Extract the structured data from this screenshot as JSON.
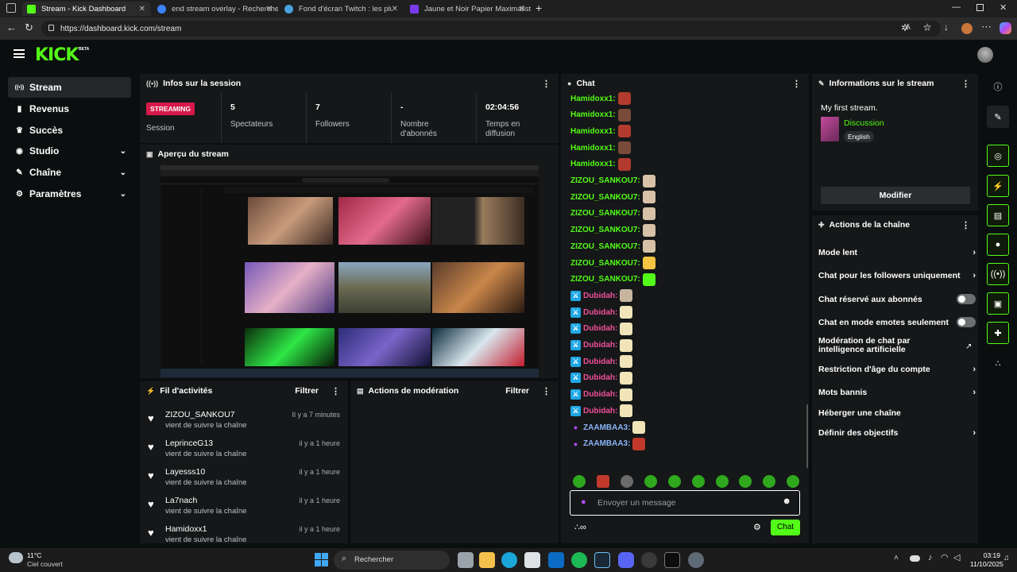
{
  "browser": {
    "tabs": [
      {
        "title": "Stream - Kick Dashboard",
        "color": "#53fc18"
      },
      {
        "title": "end stream overlay - Recherche",
        "color": "#3b82f6"
      },
      {
        "title": "Fond d'écran Twitch : les plus bea",
        "color": "#4aa3df"
      },
      {
        "title": "Jaune et Noir Papier Maximaliste",
        "color": "#7c3aed"
      }
    ],
    "url": "https://dashboard.kick.com/stream"
  },
  "brand": {
    "logo": "KICK",
    "beta": "BETA",
    "accent": "#53fc18"
  },
  "sidebar": {
    "items": [
      {
        "label": "Stream",
        "icon": "broadcast-icon",
        "glyph": "((•))"
      },
      {
        "label": "Revenus",
        "icon": "chart-icon",
        "glyph": "▮"
      },
      {
        "label": "Succès",
        "icon": "trophy-icon",
        "glyph": "♛"
      },
      {
        "label": "Studio",
        "icon": "studio-icon",
        "glyph": "◉"
      },
      {
        "label": "Chaîne",
        "icon": "channel-icon",
        "glyph": "✎"
      },
      {
        "label": "Paramètres",
        "icon": "gear-icon",
        "glyph": "⚙"
      }
    ]
  },
  "session": {
    "title": "Infos sur la session",
    "badge": "STREAMING",
    "badge_label": "Session",
    "stats": [
      {
        "value": "5",
        "label": "Spectateurs"
      },
      {
        "value": "7",
        "label": "Followers"
      },
      {
        "value": "-",
        "label": "Nombre d'abonnés"
      },
      {
        "value": "02:04:56",
        "label": "Temps en diffusion"
      }
    ]
  },
  "preview": {
    "title": "Aperçu du stream"
  },
  "activity": {
    "title": "Fil d'activités",
    "filter": "Filtrer",
    "items": [
      {
        "name": "ZIZOU_SANKOU7",
        "action": "vient de suivre la chaîne",
        "time": "Il y a 7 minutes"
      },
      {
        "name": "LeprinceG13",
        "action": "vient de suivre la chaîne",
        "time": "il y a 1 heure"
      },
      {
        "name": "Layesss10",
        "action": "vient de suivre la chaîne",
        "time": "il y a 1 heure"
      },
      {
        "name": "La7nach",
        "action": "vient de suivre la chaîne",
        "time": "il y a 1 heure"
      },
      {
        "name": "Hamidoxx1",
        "action": "vient de suivre la chaîne",
        "time": "il y a 1 heure"
      }
    ]
  },
  "moderation": {
    "title": "Actions de modération",
    "filter": "Filtrer"
  },
  "chat": {
    "title": "Chat",
    "messages": [
      {
        "user": "Hamidoxx1:",
        "color": "#53fc18",
        "badge": ""
      },
      {
        "user": "Hamidoxx1:",
        "color": "#53fc18",
        "badge": ""
      },
      {
        "user": "Hamidoxx1:",
        "color": "#53fc18",
        "badge": ""
      },
      {
        "user": "Hamidoxx1:",
        "color": "#53fc18",
        "badge": ""
      },
      {
        "user": "Hamidoxx1:",
        "color": "#53fc18",
        "badge": ""
      },
      {
        "user": "ZIZOU_SANKOU7:",
        "color": "#53fc18",
        "badge": ""
      },
      {
        "user": "ZIZOU_SANKOU7:",
        "color": "#53fc18",
        "badge": ""
      },
      {
        "user": "ZIZOU_SANKOU7:",
        "color": "#53fc18",
        "badge": ""
      },
      {
        "user": "ZIZOU_SANKOU7:",
        "color": "#53fc18",
        "badge": ""
      },
      {
        "user": "ZIZOU_SANKOU7:",
        "color": "#53fc18",
        "badge": ""
      },
      {
        "user": "ZIZOU_SANKOU7:",
        "color": "#53fc18",
        "badge": ""
      },
      {
        "user": "ZIZOU_SANKOU7:",
        "color": "#53fc18",
        "badge": ""
      },
      {
        "user": "Dubidah:",
        "color": "#f0509b",
        "badge": "mod"
      },
      {
        "user": "Dubidah:",
        "color": "#f0509b",
        "badge": "mod"
      },
      {
        "user": "Dubidah:",
        "color": "#f0509b",
        "badge": "mod"
      },
      {
        "user": "Dubidah:",
        "color": "#f0509b",
        "badge": "mod"
      },
      {
        "user": "Dubidah:",
        "color": "#f0509b",
        "badge": "mod"
      },
      {
        "user": "Dubidah:",
        "color": "#f0509b",
        "badge": "mod"
      },
      {
        "user": "Dubidah:",
        "color": "#f0509b",
        "badge": "mod"
      },
      {
        "user": "Dubidah:",
        "color": "#f0509b",
        "badge": "mod"
      },
      {
        "user": "ZAAMBAA3:",
        "color": "#8ab4f8",
        "badge": "mic"
      },
      {
        "user": "ZAAMBAA3:",
        "color": "#8ab4f8",
        "badge": "mic"
      }
    ],
    "placeholder": "Envoyer un message",
    "send": "Chat"
  },
  "stream_info": {
    "title": "Informations sur le stream",
    "stream_title": "My first stream.",
    "category": "Discussion",
    "language": "English",
    "edit": "Modifier"
  },
  "channel_actions": {
    "title": "Actions de la chaîne",
    "items": [
      {
        "label": "Mode lent",
        "control": "chevron"
      },
      {
        "label": "Chat pour les followers uniquement",
        "control": "chevron"
      },
      {
        "label": "Chat réservé aux abonnés",
        "control": "toggle"
      },
      {
        "label": "Chat en mode emotes seulement",
        "control": "toggle"
      },
      {
        "label": "Modération de chat par intelligence artificielle",
        "control": "external"
      },
      {
        "label": "Restriction d'âge du compte",
        "control": "chevron"
      },
      {
        "label": "Mots bannis",
        "control": "chevron"
      },
      {
        "label": "Héberger une chaîne",
        "control": "none"
      },
      {
        "label": "Définir des objectifs",
        "control": "chevron"
      }
    ]
  },
  "taskbar": {
    "weather_temp": "11°C",
    "weather_desc": "Ciel couvert",
    "search": "Rechercher",
    "time": "03:19",
    "date": "11/10/2025"
  }
}
